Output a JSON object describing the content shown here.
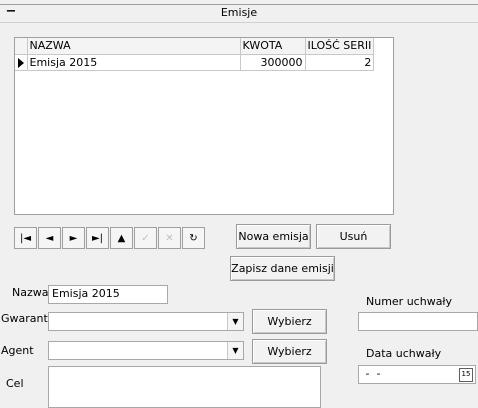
{
  "panel": {
    "collapse_label": "−",
    "title": "Emisje"
  },
  "grid": {
    "columns": [
      "NAZWA",
      "KWOTA",
      "ILOŚĆ SERII"
    ],
    "rows": [
      {
        "nazwa": "Emisja 2015",
        "kwota": "300000",
        "ilosc": "2"
      }
    ]
  },
  "navigator": {
    "icons": [
      "first-icon",
      "prev-icon",
      "next-icon",
      "last-icon",
      "insert-icon",
      "edit-icon",
      "delete-icon",
      "refresh-icon"
    ],
    "glyphs": [
      "|◄",
      "◄",
      "►",
      "►|",
      "▲",
      "✓",
      "✕",
      "↻"
    ]
  },
  "buttons": {
    "nowa": "Nowa emisja",
    "usun": "Usuń",
    "zapisz": "Zapisz dane emisji",
    "wybierz_gwarant": "Wybierz",
    "wybierz_agent": "Wybierz"
  },
  "form": {
    "nazwa_label": "Nazwa",
    "nazwa_value": "Emisja 2015",
    "gwarant_label": "Gwarant",
    "gwarant_value": "",
    "agent_label": "Agent",
    "agent_value": "",
    "cel_label": "Cel",
    "cel_value": "",
    "numer_label": "Numer uchwały",
    "numer_value": "",
    "data_label": "Data uchwały",
    "data_value": " -  -",
    "calendar_glyph": "15"
  }
}
